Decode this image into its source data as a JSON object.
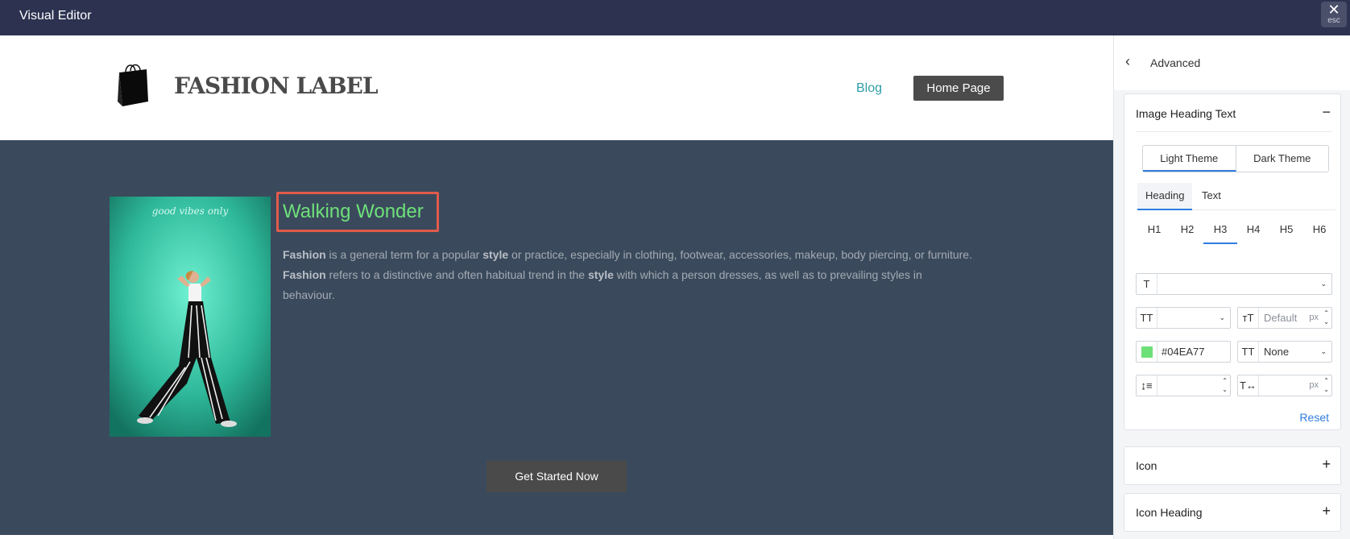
{
  "topbar": {
    "title": "Visual Editor",
    "close_glyph": "✕",
    "esc_label": "esc"
  },
  "site": {
    "logo_text": "FASHION LABEL",
    "nav_blog": "Blog",
    "nav_home": "Home Page"
  },
  "hero": {
    "heading": "Walking Wonder",
    "paragraph": {
      "w1": "Fashion",
      "t1": " is a general term for a popular ",
      "w2": "style",
      "t2": " or practice, especially in clothing, footwear, accessories, makeup, body piercing, or furniture. ",
      "w3": "Fashion",
      "t3": " refers to a distinctive and often habitual trend in the ",
      "w4": "style",
      "t4": " with which a person dresses, as well as to prevailing styles in behaviour."
    },
    "cta": "Get Started Now",
    "neon_sign": "good vibes only"
  },
  "panel": {
    "back_icon": "‹",
    "title": "Advanced",
    "section_image_heading": {
      "title": "Image Heading Text",
      "toggle": "−",
      "themes": [
        "Light Theme",
        "Dark Theme"
      ],
      "tabs": [
        "Heading",
        "Text"
      ],
      "levels": [
        "H1",
        "H2",
        "H3",
        "H4",
        "H5",
        "H6"
      ],
      "font_family_icon": "T",
      "font_weight_icon": "TT",
      "font_size_icon": "тT",
      "font_size_placeholder": "Default",
      "unit_px": "px",
      "color_value": "#04EA77",
      "transform_icon": "TT",
      "transform_value": "None",
      "line_height_icon": "↨≡",
      "letter_spacing_icon": "T↔",
      "reset": "Reset"
    },
    "section_icon": {
      "title": "Icon",
      "toggle": "+"
    },
    "section_icon_heading": {
      "title": "Icon Heading",
      "toggle": "+"
    }
  },
  "colors": {
    "accent": "#2f7de1",
    "heading_green": "#6ee07a",
    "hero_bg": "#3a4a5c",
    "highlight": "#e25a4a"
  }
}
